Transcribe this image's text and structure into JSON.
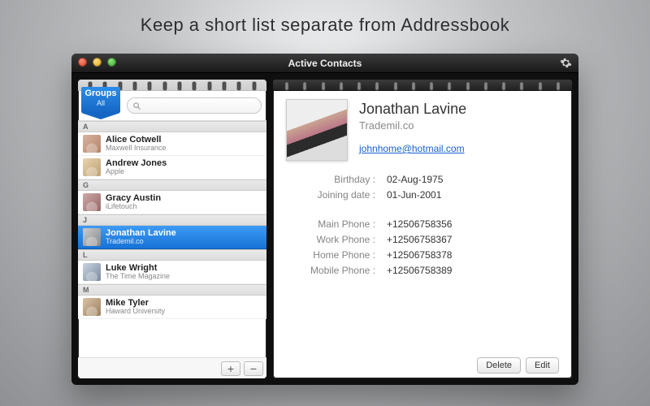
{
  "promo": {
    "tagline": "Keep a short list separate from Addressbook"
  },
  "window": {
    "title": "Active Contacts"
  },
  "sidebar": {
    "groups_label": "Groups",
    "groups_current": "All",
    "search_placeholder": "",
    "sections": [
      {
        "letter": "A",
        "items": [
          {
            "name": "Alice Cotwell",
            "company": "Maxwell Insurance"
          },
          {
            "name": "Andrew Jones",
            "company": "Apple"
          }
        ]
      },
      {
        "letter": "G",
        "items": [
          {
            "name": "Gracy  Austin",
            "company": "iLifetouch"
          }
        ]
      },
      {
        "letter": "J",
        "items": [
          {
            "name": "Jonathan  Lavine",
            "company": "Trademil.co",
            "selected": true
          }
        ]
      },
      {
        "letter": "L",
        "items": [
          {
            "name": "Luke Wright",
            "company": "The Time Magazine"
          }
        ]
      },
      {
        "letter": "M",
        "items": [
          {
            "name": "Mike Tyler",
            "company": "Haward University"
          }
        ]
      }
    ],
    "add_label": "+",
    "remove_label": "−"
  },
  "detail": {
    "name": "Jonathan  Lavine",
    "company": "Trademil.co",
    "email": "johnhome@hotmail.com",
    "fields": [
      {
        "label": "Birthday :",
        "value": "02-Aug-1975"
      },
      {
        "label": "Joining date :",
        "value": "01-Jun-2001"
      }
    ],
    "phones": [
      {
        "label": "Main Phone :",
        "value": "+12506758356"
      },
      {
        "label": "Work Phone :",
        "value": "+12506758367"
      },
      {
        "label": "Home Phone :",
        "value": "+12506758378"
      },
      {
        "label": "Mobile Phone :",
        "value": "+12506758389"
      }
    ],
    "delete_label": "Delete",
    "edit_label": "Edit"
  }
}
